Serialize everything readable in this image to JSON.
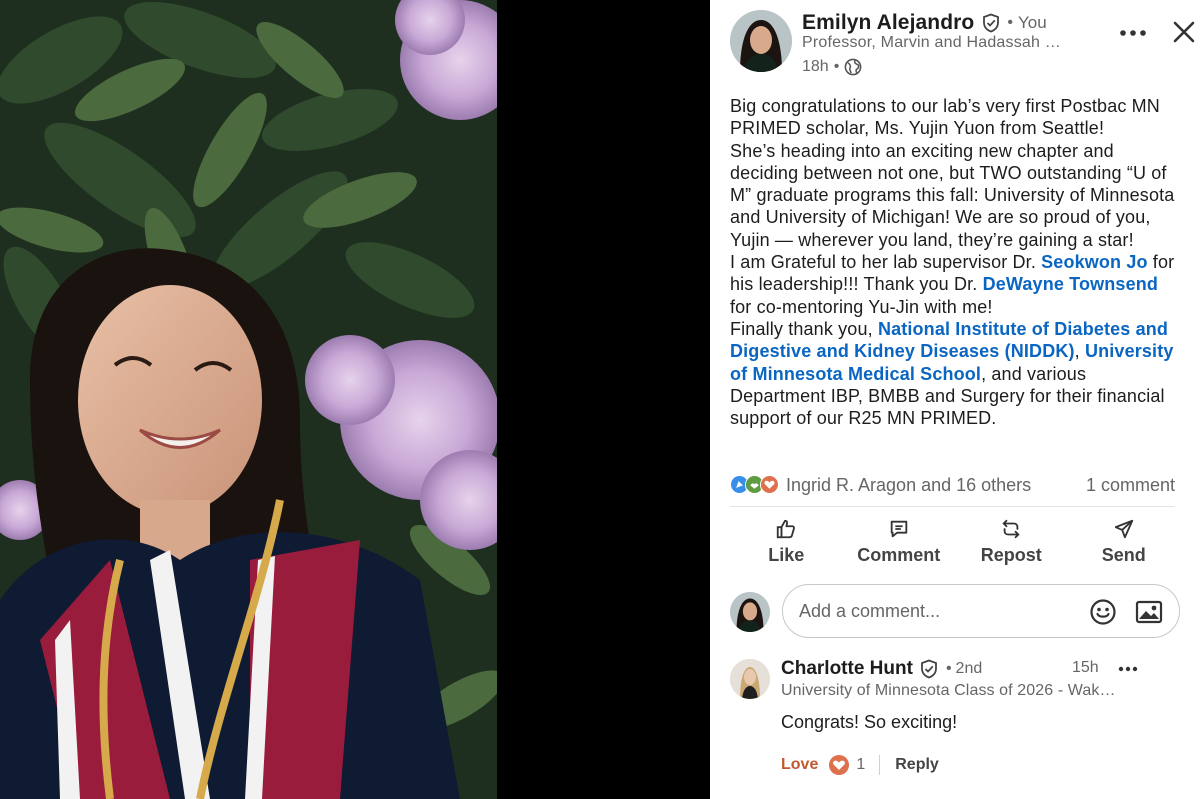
{
  "post": {
    "author": {
      "name": "Emilyn Alejandro",
      "relation_sep": "•",
      "relation": "You",
      "headline": "Professor, Marvin and Hadassah …",
      "time": "18h",
      "time_sep": "•",
      "visibility_icon": "globe-icon",
      "verified_icon": "verified-shield-icon"
    },
    "body": {
      "p1": "Big congratulations to our lab’s very first Postbac MN PRIMED scholar, Ms. Yujin Yuon from Seattle!",
      "p2": "She’s heading into an exciting new chapter and deciding between not one, but TWO outstanding “U of M” graduate programs this fall: University of Minnesota and University of Michigan! We are so proud of you, Yujin — wherever you land, they’re gaining a star!",
      "p3_pre": "I am Grateful to her lab supervisor Dr. ",
      "p3_mention": "Seokwon Jo",
      "p3_post": " for his leadership!!!  Thank you Dr. ",
      "p3_mention2": "DeWayne Townsend",
      "p3_post2": " for co-mentoring Yu-Jin with me!",
      "p4_pre": "Finally thank you, ",
      "p4_mention1": "National Institute of Diabetes and Digestive and Kidney Diseases (NIDDK)",
      "p4_comma": ", ",
      "p4_mention2": "University of Minnesota Medical School",
      "p4_post": ", and various Department IBP, BMBB and Surgery for their financial support of our R25 MN PRIMED."
    },
    "reactions": {
      "icons": [
        "celebrate-icon",
        "support-icon",
        "love-icon"
      ],
      "summary": "Ingrid R. Aragon and 16 others",
      "comments_count": "1 comment"
    },
    "actions": [
      {
        "label": "Like",
        "icon": "thumbs-up-icon"
      },
      {
        "label": "Comment",
        "icon": "comment-bubble-icon"
      },
      {
        "label": "Repost",
        "icon": "repost-icon"
      },
      {
        "label": "Send",
        "icon": "send-icon"
      }
    ]
  },
  "comment_box": {
    "placeholder": "Add a comment...",
    "emoji_icon": "emoji-icon",
    "image_icon": "image-icon"
  },
  "comments": [
    {
      "name": "Charlotte Hunt",
      "degree_sep": "•",
      "degree": "2nd",
      "headline": "University of Minnesota Class of 2026 - Wak…",
      "time": "15h",
      "text": "Congrats! So exciting!",
      "reaction_label": "Love",
      "reaction_count": "1",
      "reply_label": "Reply"
    }
  ],
  "colors": {
    "link": "#0a66c2",
    "love": "#c35930",
    "muted": "#666666",
    "photo_backdrop": "#000000"
  }
}
